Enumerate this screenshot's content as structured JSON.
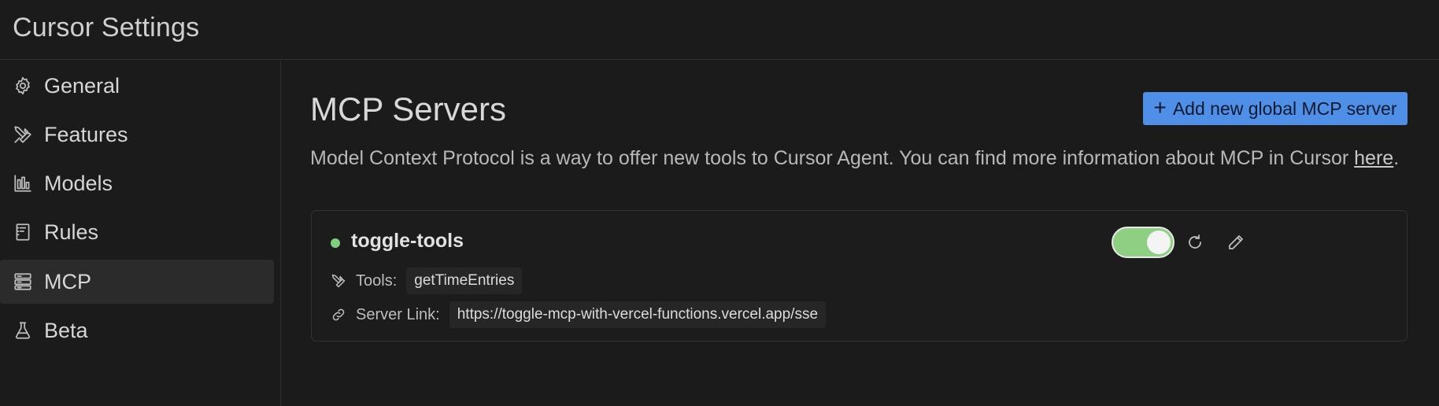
{
  "window": {
    "title": "Cursor Settings"
  },
  "sidebar": {
    "items": [
      {
        "label": "General",
        "icon": "gear-icon",
        "active": false
      },
      {
        "label": "Features",
        "icon": "tools-icon",
        "active": false
      },
      {
        "label": "Models",
        "icon": "bar-chart-icon",
        "active": false
      },
      {
        "label": "Rules",
        "icon": "notebook-icon",
        "active": false
      },
      {
        "label": "MCP",
        "icon": "server-icon",
        "active": true
      },
      {
        "label": "Beta",
        "icon": "flask-icon",
        "active": false
      }
    ]
  },
  "main": {
    "title": "MCP Servers",
    "add_button_label": "Add new global MCP server",
    "description_prefix": "Model Context Protocol is a way to offer new tools to Cursor Agent. You can find more information about MCP in Cursor ",
    "description_link": "here",
    "description_suffix": ".",
    "servers": [
      {
        "name": "toggle-tools",
        "status": "running",
        "enabled": true,
        "tools_label": "Tools:",
        "tools": [
          "getTimeEntries"
        ],
        "link_label": "Server Link:",
        "link": "https://toggle-mcp-with-vercel-functions.vercel.app/sse"
      }
    ]
  },
  "colors": {
    "accent": "#4f8fe8",
    "status_green": "#7fcf7f",
    "toggle_on": "#8fcf83",
    "background": "#1b1b1b"
  }
}
